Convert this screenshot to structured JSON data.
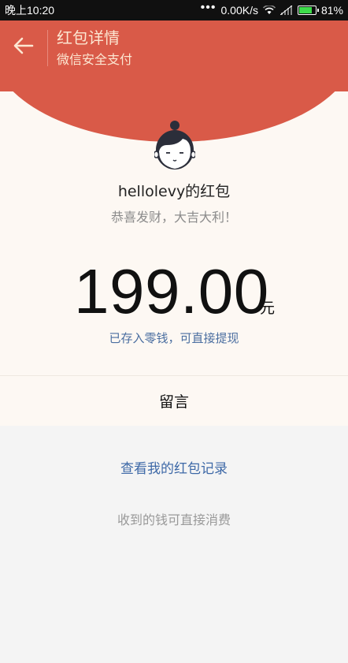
{
  "status_bar": {
    "time": "晚上10:20",
    "network_speed": "0.00K/s",
    "battery_percent": "81%",
    "battery_level": 0.81,
    "icons": [
      "wifi-icon",
      "signal-icon",
      "battery-icon"
    ]
  },
  "header": {
    "title": "红包详情",
    "subtitle": "微信安全支付",
    "back_icon": "arrow-left-icon",
    "color": "#d95a48"
  },
  "envelope": {
    "sender": "hellolevy的红包",
    "greeting": "恭喜发财，大吉大利！",
    "amount": "199.00",
    "unit": "元",
    "saved_note": "已存入零钱，可直接提现",
    "avatar_icon": "avatar-face-icon"
  },
  "actions": {
    "message_label": "留言",
    "records_link": "查看我的红包记录",
    "footnote": "收到的钱可直接消费"
  },
  "colors": {
    "accent_text": "#fce7d2",
    "link": "#3e69a7",
    "card_bg": "#fdf8f3"
  }
}
